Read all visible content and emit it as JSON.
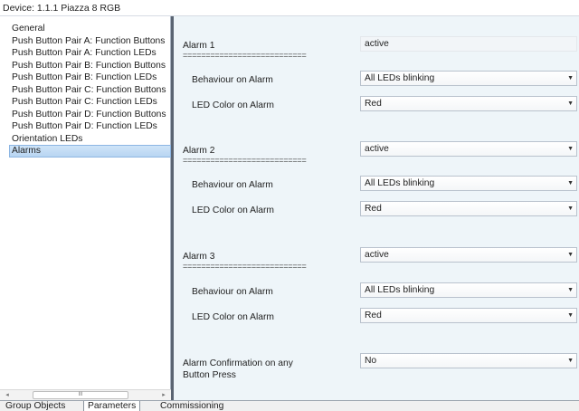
{
  "window": {
    "title": "Device: 1.1.1  Piazza 8 RGB"
  },
  "sidebar": {
    "items": [
      {
        "label": "General"
      },
      {
        "label": "Push Button Pair A: Function Buttons"
      },
      {
        "label": "Push Button Pair A: Function LEDs"
      },
      {
        "label": "Push Button Pair B: Function Buttons"
      },
      {
        "label": "Push Button Pair B: Function LEDs"
      },
      {
        "label": "Push Button Pair C: Function Buttons"
      },
      {
        "label": "Push Button Pair C: Function LEDs"
      },
      {
        "label": "Push Button Pair D: Function Buttons"
      },
      {
        "label": "Push Button Pair D: Function LEDs"
      },
      {
        "label": "Orientation LEDs"
      },
      {
        "label": "Alarms",
        "selected": true
      }
    ],
    "scrollbar": {
      "left_icon": "◂",
      "thumb_label": "III",
      "right_icon": "▸"
    }
  },
  "separator_text": "===========================",
  "params": {
    "alarm1": {
      "label": "Alarm 1",
      "value": "active",
      "behaviour_label": "Behaviour on Alarm",
      "behaviour_value": "All LEDs blinking",
      "color_label": "LED Color on Alarm",
      "color_value": "Red"
    },
    "alarm2": {
      "label": "Alarm 2",
      "value": "active",
      "behaviour_label": "Behaviour on Alarm",
      "behaviour_value": "All LEDs blinking",
      "color_label": "LED Color on Alarm",
      "color_value": "Red"
    },
    "alarm3": {
      "label": "Alarm 3",
      "value": "active",
      "behaviour_label": "Behaviour on Alarm",
      "behaviour_value": "All LEDs blinking",
      "color_label": "LED Color on Alarm",
      "color_value": "Red"
    },
    "confirmation": {
      "label_line1": "Alarm Confirmation on any",
      "label_line2": "Button Press",
      "value": "No"
    }
  },
  "tabs": [
    {
      "label": "Group Objects"
    },
    {
      "label": "Parameters",
      "active": true
    },
    {
      "label": "Commissioning"
    }
  ],
  "icons": {
    "dropdown": "chevron-down-icon"
  },
  "colors": {
    "selection": "#cfe4f8",
    "panel_bg": "#eef5f9",
    "divider": "#5a6472"
  }
}
